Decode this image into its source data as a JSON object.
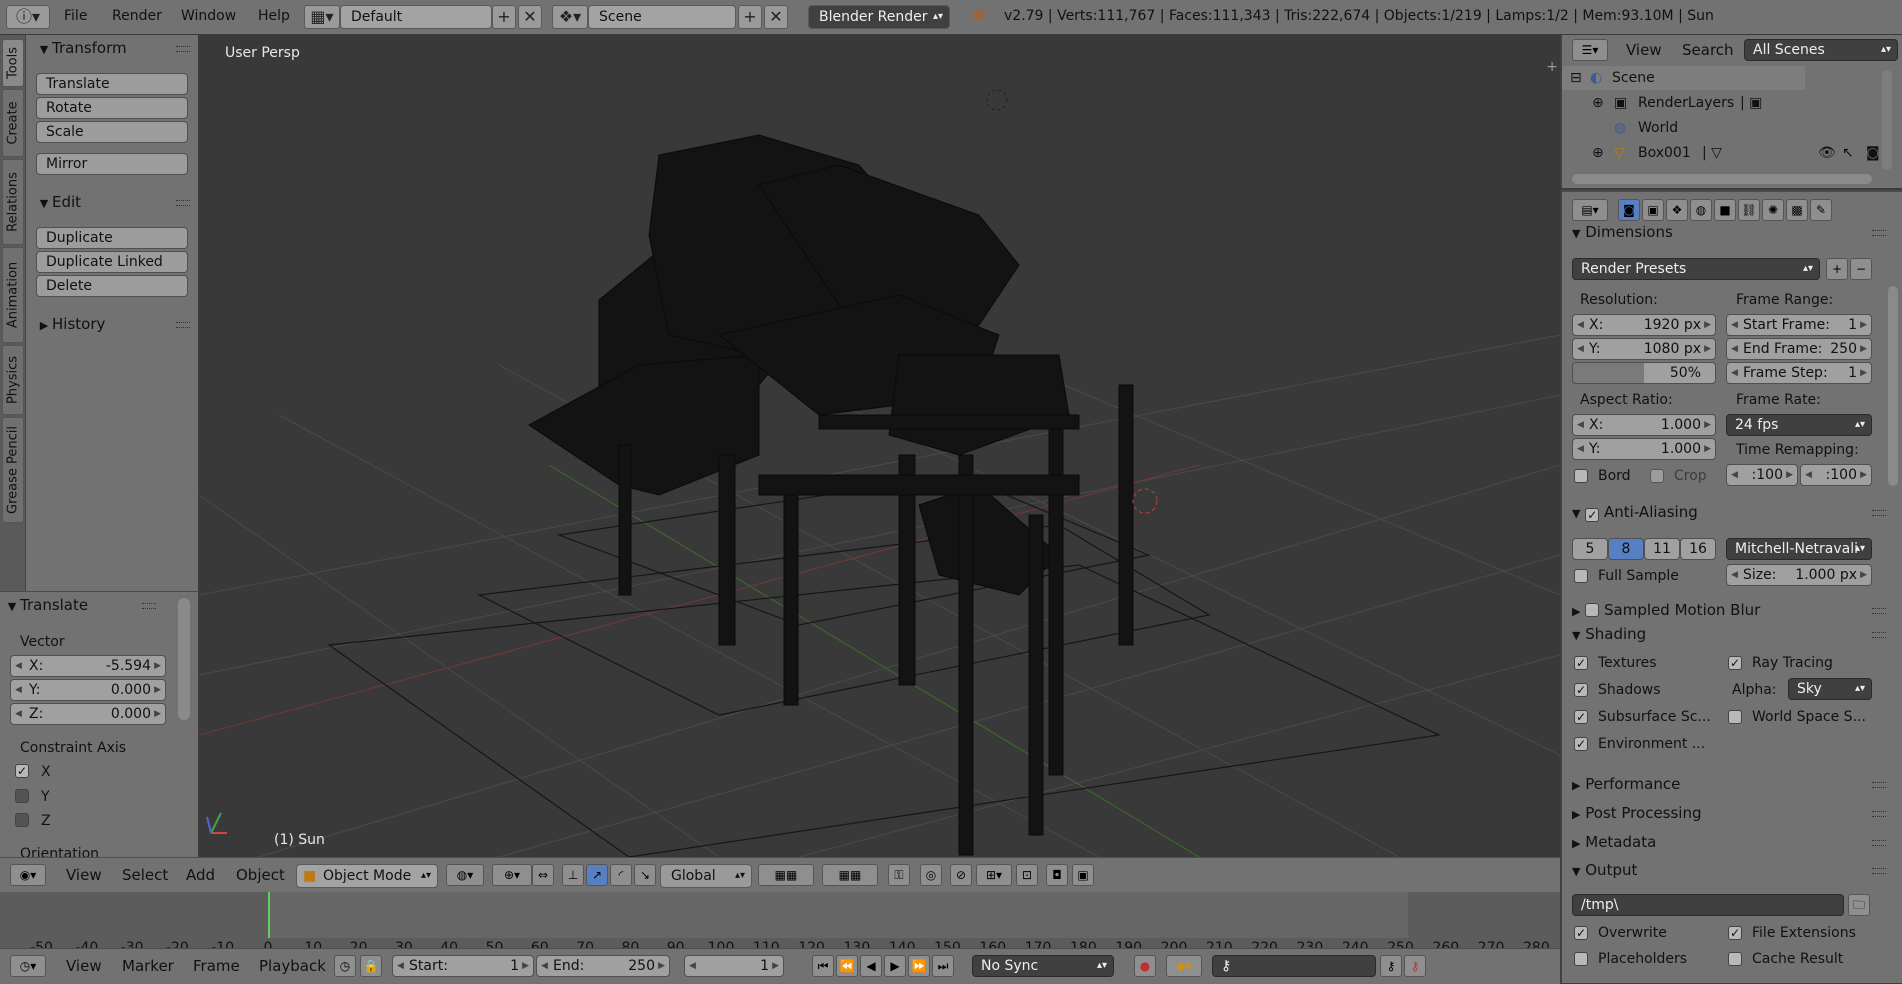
{
  "topbar": {
    "menus": [
      "File",
      "Render",
      "Window",
      "Help"
    ],
    "screen_layout": "Default",
    "scene": "Scene",
    "render_engine": "Blender Render",
    "stats": "v2.79 | Verts:111,767 | Faces:111,343 | Tris:222,674 | Objects:1/219 | Lamps:1/2 | Mem:93.10M | Sun"
  },
  "tool_tabs": [
    "Tools",
    "Create",
    "Relations",
    "Animation",
    "Physics",
    "Grease Pencil"
  ],
  "toolshelf": {
    "transform_title": "Transform",
    "transform_buttons": [
      "Translate",
      "Rotate",
      "Scale"
    ],
    "mirror": "Mirror",
    "edit_title": "Edit",
    "edit_buttons": [
      "Duplicate",
      "Duplicate Linked",
      "Delete"
    ],
    "history_title": "History"
  },
  "operator": {
    "title": "Translate",
    "vector_label": "Vector",
    "x_label": "X:",
    "x_value": "-5.594",
    "y_label": "Y:",
    "y_value": "0.000",
    "z_label": "Z:",
    "z_value": "0.000",
    "constraint_label": "Constraint Axis",
    "axes": [
      {
        "label": "X",
        "checked": true
      },
      {
        "label": "Y",
        "checked": false
      },
      {
        "label": "Z",
        "checked": false
      }
    ],
    "orientation_label": "Orientation"
  },
  "viewport": {
    "view_name": "User Persp",
    "object_label": "(1) Sun"
  },
  "view3d_header": {
    "menus": [
      "View",
      "Select",
      "Add",
      "Object"
    ],
    "mode": "Object Mode",
    "orientation": "Global"
  },
  "timeline": {
    "ticks": [
      "-50",
      "-40",
      "-30",
      "-20",
      "-10",
      "0",
      "10",
      "20",
      "30",
      "40",
      "50",
      "60",
      "70",
      "80",
      "90",
      "100",
      "110",
      "120",
      "130",
      "140",
      "150",
      "160",
      "170",
      "180",
      "190",
      "200",
      "210",
      "220",
      "230",
      "240",
      "250",
      "260",
      "270",
      "280"
    ],
    "menus": [
      "View",
      "Marker",
      "Frame",
      "Playback"
    ],
    "start_label": "Start:",
    "start_value": "1",
    "end_label": "End:",
    "end_value": "250",
    "current_frame": "1",
    "sync": "No Sync"
  },
  "outliner": {
    "menus": [
      "View",
      "Search"
    ],
    "filter": "All Scenes",
    "rows": [
      "Scene",
      "RenderLayers",
      "World",
      "Box001"
    ]
  },
  "properties": {
    "dimensions_title": "Dimensions",
    "render_presets": "Render Presets",
    "resolution_label": "Resolution:",
    "res_x_label": "X:",
    "res_x": "1920 px",
    "res_y_label": "Y:",
    "res_y": "1080 px",
    "res_pct": "50%",
    "frame_range_label": "Frame Range:",
    "start_frame_label": "Start Frame:",
    "start_frame": "1",
    "end_frame_label": "End Frame:",
    "end_frame": "250",
    "frame_step_label": "Frame Step:",
    "frame_step": "1",
    "aspect_label": "Aspect Ratio:",
    "aspect_x_label": "X:",
    "aspect_x": "1.000",
    "aspect_y_label": "Y:",
    "aspect_y": "1.000",
    "frame_rate_label": "Frame Rate:",
    "frame_rate": "24 fps",
    "time_remap_label": "Time Remapping:",
    "remap_old": ":100",
    "remap_new": ":100",
    "bord": "Bord",
    "crop": "Crop",
    "aa_title": "Anti-Aliasing",
    "aa_samples": [
      "5",
      "8",
      "11",
      "16"
    ],
    "aa_active": "8",
    "aa_filter": "Mitchell-Netravali",
    "full_sample": "Full Sample",
    "size_label": "Size:",
    "size_value": "1.000 px",
    "motion_blur_title": "Sampled Motion Blur",
    "shading_title": "Shading",
    "textures": "Textures",
    "ray_tracing": "Ray Tracing",
    "shadows": "Shadows",
    "alpha_label": "Alpha:",
    "alpha_value": "Sky",
    "subsurface": "Subsurface Sc...",
    "world_space": "World Space S...",
    "environment": "Environment ...",
    "performance_title": "Performance",
    "post_processing_title": "Post Processing",
    "metadata_title": "Metadata",
    "output_title": "Output",
    "output_path": "/tmp\\",
    "overwrite": "Overwrite",
    "file_extensions": "File Extensions",
    "placeholders": "Placeholders",
    "cache_result": "Cache Result"
  },
  "colors": {
    "accent_blue": "#5680c2",
    "viewport_bg": "#393939",
    "panel_bg": "#727272"
  }
}
